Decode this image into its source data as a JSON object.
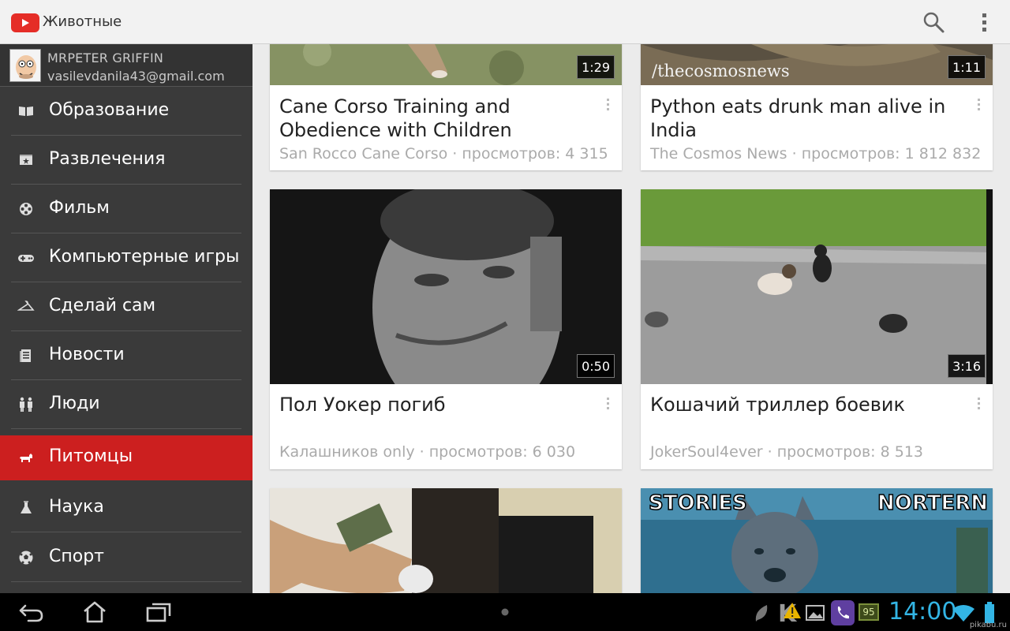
{
  "app": {
    "title": "Животные"
  },
  "account": {
    "name": "MRPETER GRIFFIN",
    "email": "vasilevdanila43@gmail.com"
  },
  "sidebar": {
    "items": [
      {
        "label": "Образование",
        "icon": "book-icon",
        "active": false
      },
      {
        "label": "Развлечения",
        "icon": "ticket-icon",
        "active": false
      },
      {
        "label": "Фильм",
        "icon": "film-reel-icon",
        "active": false
      },
      {
        "label": "Компьютерные игры",
        "icon": "gamepad-icon",
        "active": false
      },
      {
        "label": "Сделай сам",
        "icon": "hanger-icon",
        "active": false
      },
      {
        "label": "Новости",
        "icon": "newspaper-icon",
        "active": false
      },
      {
        "label": "Люди",
        "icon": "people-icon",
        "active": false
      },
      {
        "label": "Питомцы",
        "icon": "dog-icon",
        "active": true
      },
      {
        "label": "Наука",
        "icon": "flask-icon",
        "active": false
      },
      {
        "label": "Спорт",
        "icon": "soccer-ball-icon",
        "active": false
      }
    ]
  },
  "videos": [
    {
      "title": "Cane Corso Training and Obedience with Children",
      "channel": "San Rocco Cane Corso",
      "views": "просмотров: 4 315",
      "duration": "1:29"
    },
    {
      "title": "Python eats drunk man alive in India",
      "channel": "The Cosmos News",
      "views": "просмотров: 1 812 832",
      "duration": "1:11",
      "thumb_text": "/thecosmosnews"
    },
    {
      "title": "Пол Уокер погиб",
      "channel": "Калашников only",
      "views": "просмотров: 6 030",
      "duration": "0:50"
    },
    {
      "title": "Кошачий триллер боевик",
      "channel": "JokerSoul4ever",
      "views": "просмотров: 8 513",
      "duration": "3:16"
    },
    {
      "thumb_caption_left": "STORIES",
      "thumb_caption_right": "NORTERN"
    }
  ],
  "status": {
    "time": "14:00",
    "battery_badge": "95",
    "watermark": "pikabu.ru"
  },
  "colors": {
    "brand_red": "#cc1f1f",
    "clock_blue": "#33b5e5",
    "sidebar_bg": "#3a3a3a"
  }
}
